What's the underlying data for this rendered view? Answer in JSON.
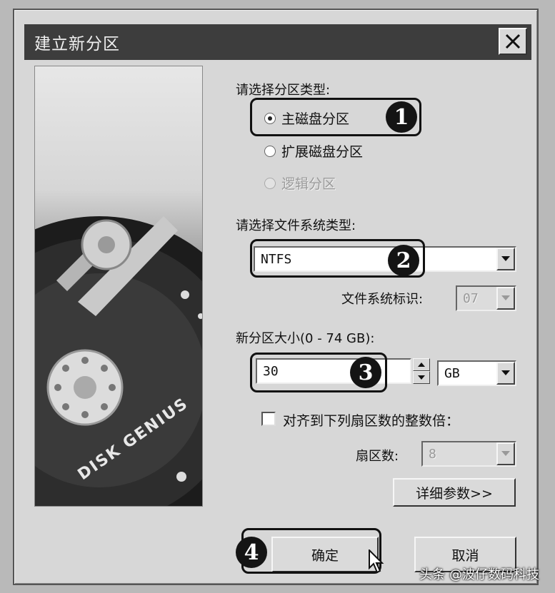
{
  "dialog": {
    "title": "建立新分区",
    "close_icon": "close-icon"
  },
  "image": {
    "brand_text": "DISK GENIUS"
  },
  "partition_type": {
    "label": "请选择分区类型:",
    "options": [
      {
        "label": "主磁盘分区",
        "selected": true,
        "enabled": true
      },
      {
        "label": "扩展磁盘分区",
        "selected": false,
        "enabled": true
      },
      {
        "label": "逻辑分区",
        "selected": false,
        "enabled": false
      }
    ]
  },
  "filesystem": {
    "label": "请选择文件系统类型:",
    "value": "NTFS",
    "id_label": "文件系统标识:",
    "id_value": "07"
  },
  "size": {
    "label": "新分区大小(0 - 74 GB):",
    "value": "30",
    "unit": "GB"
  },
  "align": {
    "label": "对齐到下列扇区数的整数倍：",
    "checked": false,
    "sectors_label": "扇区数:",
    "sectors_value": "8"
  },
  "buttons": {
    "details": "详细参数>>",
    "ok": "确定",
    "cancel": "取消"
  },
  "steps": [
    "1",
    "2",
    "3",
    "4"
  ],
  "watermark": "头条 @波仔数码科技"
}
